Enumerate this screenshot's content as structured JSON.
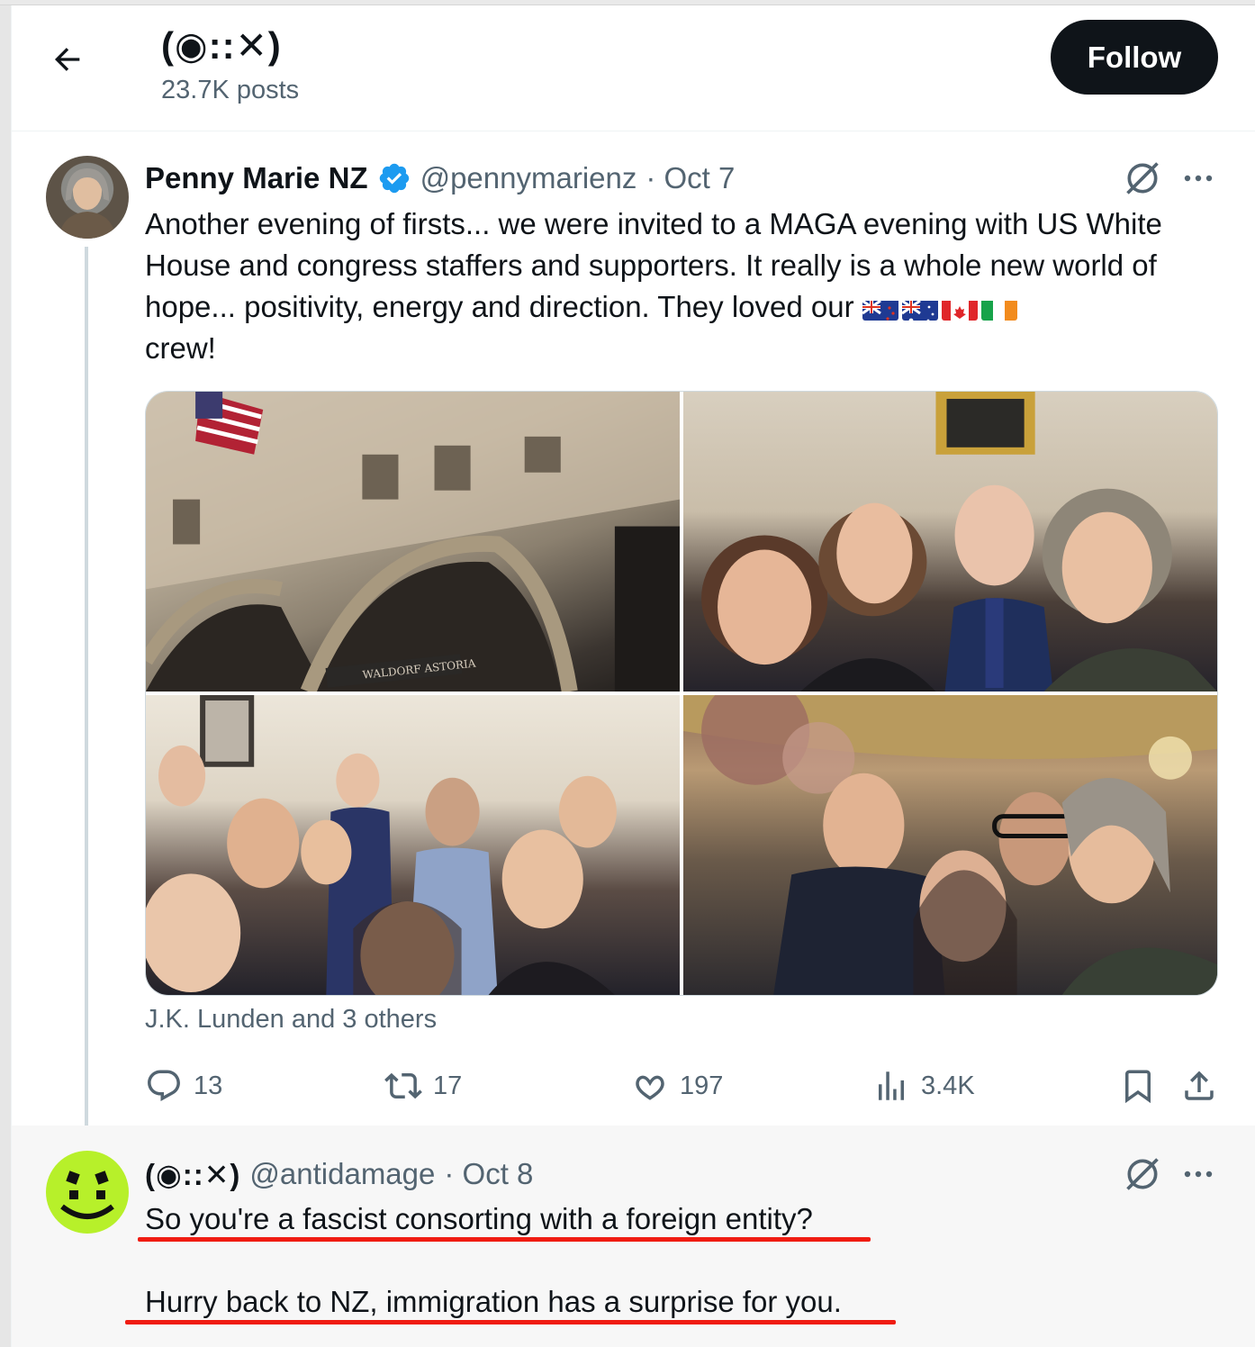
{
  "header": {
    "title": "(◉::✕)",
    "posts_count": "23.7K posts",
    "follow_label": "Follow"
  },
  "tweet": {
    "author_name": "Penny Marie NZ",
    "verified": true,
    "handle": "@pennymarienz",
    "date": "· Oct 7",
    "text_main": "Another evening of firsts... we were invited to a MAGA evening with US White House and congress staffers and supporters. It really is a whole new world of hope... positivity, energy and direction. They loved our ",
    "flags": [
      "flag-new-zealand",
      "flag-australia",
      "flag-canada",
      "flag-ireland"
    ],
    "text_end": "crew!",
    "photos": [
      {
        "description_icon": "building-photo",
        "sign_text": "WALDORF ASTORIA"
      },
      {
        "description_icon": "group-photo"
      },
      {
        "description_icon": "group-photo"
      },
      {
        "description_icon": "group-photo"
      }
    ],
    "liked_by": "J.K. Lunden and 3 others",
    "stats": {
      "replies": "13",
      "reposts": "17",
      "likes": "197",
      "views": "3.4K"
    }
  },
  "reply": {
    "author_name": "(◉::✕)",
    "handle": "@antidamage",
    "date": "· Oct 8",
    "line1": "So you're a fascist consorting with a foreign entity?",
    "line2": "Hurry back to NZ, immigration has a surprise for you."
  },
  "colors": {
    "accent": "#1d9bf0",
    "secondary_text": "#536471",
    "underline_red": "#f01c12",
    "reply_avatar": "#b7f02a"
  }
}
